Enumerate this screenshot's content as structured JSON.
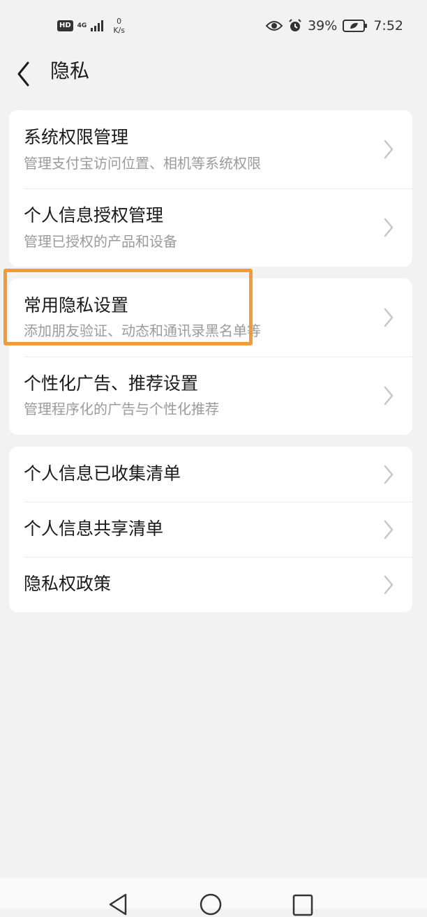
{
  "status_bar": {
    "hd": "HD",
    "network": "4G",
    "speed_value": "0",
    "speed_unit": "K/s",
    "battery_percent": "39%",
    "time": "7:52"
  },
  "header": {
    "title": "隐私"
  },
  "groups": [
    {
      "items": [
        {
          "title": "系统权限管理",
          "subtitle": "管理支付宝访问位置、相机等系统权限"
        },
        {
          "title": "个人信息授权管理",
          "subtitle": "管理已授权的产品和设备"
        }
      ]
    },
    {
      "items": [
        {
          "title": "常用隐私设置",
          "subtitle": "添加朋友验证、动态和通讯录黑名单等"
        },
        {
          "title": "个性化广告、推荐设置",
          "subtitle": "管理程序化的广告与个性化推荐"
        }
      ]
    },
    {
      "items": [
        {
          "title": "个人信息已收集清单"
        },
        {
          "title": "个人信息共享清单"
        },
        {
          "title": "隐私权政策"
        }
      ]
    }
  ],
  "icons": {
    "back": "chevron-left-icon",
    "row_arrow": "chevron-right-icon",
    "eye": "eye-icon",
    "alarm": "alarm-icon",
    "battery": "battery-icon",
    "nav_back": "triangle-back-icon",
    "nav_home": "circle-home-icon",
    "nav_recent": "square-recent-icon"
  },
  "colors": {
    "background": "#f2f2f2",
    "card": "#ffffff",
    "highlight_box": "#f29a3c",
    "subtitle": "#9b9b9b"
  }
}
